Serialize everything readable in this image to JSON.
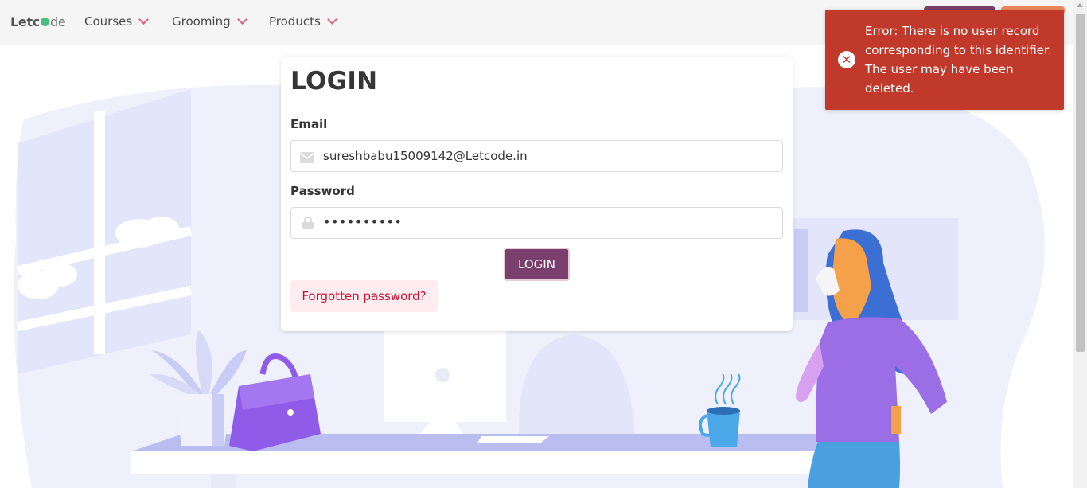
{
  "navbar": {
    "logo_text_a": "Let",
    "logo_text_b": "de",
    "items": [
      {
        "label": "Courses"
      },
      {
        "label": "Grooming"
      },
      {
        "label": "Products"
      }
    ]
  },
  "login": {
    "title": "LOGIN",
    "email_label": "Email",
    "email_value": "sureshbabu15009142@Letcode.in",
    "password_label": "Password",
    "password_masked": "••••••••••",
    "submit_label": "LOGIN",
    "forgot_label": "Forgotten password?"
  },
  "toast": {
    "message": "Error: There is no user record corresponding to this identifier. The user may have been deleted.",
    "icon": "error-x-icon"
  },
  "colors": {
    "primary": "#7a3f6d",
    "error": "#c0392b",
    "danger_light": "#feecf0",
    "danger_text": "#cc0f35",
    "accent": "#e0607e"
  }
}
